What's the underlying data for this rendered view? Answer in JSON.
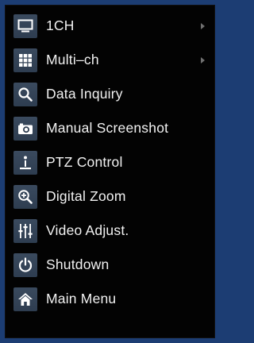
{
  "menu": {
    "items": [
      {
        "label": "1CH",
        "icon": "monitor-icon",
        "has_submenu": true
      },
      {
        "label": "Multi–ch",
        "icon": "grid-icon",
        "has_submenu": true
      },
      {
        "label": "Data Inquiry",
        "icon": "search-icon",
        "has_submenu": false
      },
      {
        "label": "Manual Screenshot",
        "icon": "camera-icon",
        "has_submenu": false
      },
      {
        "label": "PTZ Control",
        "icon": "ptz-icon",
        "has_submenu": false
      },
      {
        "label": "Digital Zoom",
        "icon": "zoom-icon",
        "has_submenu": false
      },
      {
        "label": "Video Adjust.",
        "icon": "sliders-icon",
        "has_submenu": false
      },
      {
        "label": "Shutdown",
        "icon": "power-icon",
        "has_submenu": false
      },
      {
        "label": "Main Menu",
        "icon": "home-icon",
        "has_submenu": false
      }
    ]
  },
  "colors": {
    "background": "#1c3d73",
    "menu_bg": "#030303",
    "icon_bg": "#3a4a5e",
    "text": "#f2f2f2"
  }
}
